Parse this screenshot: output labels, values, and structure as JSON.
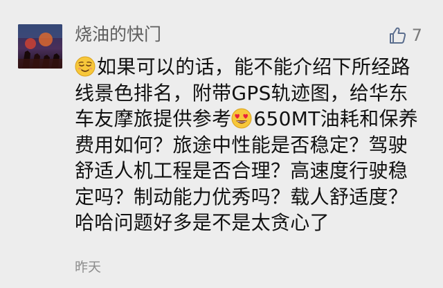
{
  "comment": {
    "author": "烧油的快门",
    "likes": "7",
    "text_before_emoji1": "如果可以的话，能不能介绍下所经路线景色排名，附带GPS轨迹图，给华东车友摩旅提供参考",
    "text_after_emoji2": "650MT油耗和保养费用如何？旅途中性能是否稳定？驾驶舒适人机工程是否合理？高速度行驶稳定吗？制动能力优秀吗？载人舒适度？哈哈问题好多是不是太贪心了",
    "time": "昨天",
    "emoji1": "relieved-face-emoji",
    "emoji2": "heart-eyes-emoji"
  },
  "colors": {
    "background": "#ededed",
    "author": "#5e5e5e",
    "text": "#111111",
    "meta": "#8c8c8c",
    "like_icon": "#5b6e8e"
  }
}
